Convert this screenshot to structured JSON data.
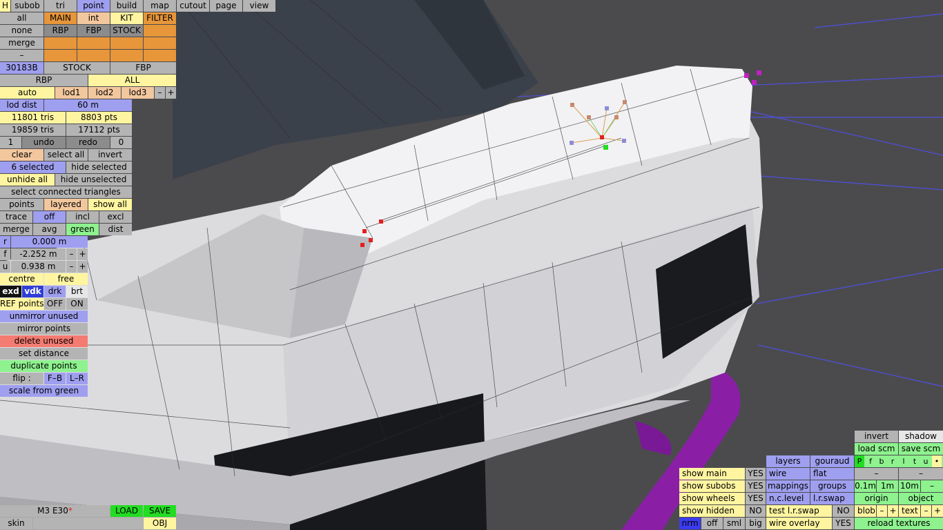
{
  "app": {
    "title": "M3 E30",
    "unsaved_mark": "*"
  },
  "menu": [
    "H",
    "subob",
    "tri",
    "point",
    "build",
    "map",
    "cutout",
    "page",
    "view"
  ],
  "kit_row1": [
    "all",
    "MAIN",
    "int",
    "KIT",
    "FILTER"
  ],
  "kit_row2": [
    "none",
    "RBP",
    "FBP",
    "STOCK"
  ],
  "kit_row3": [
    "merge"
  ],
  "kit_row4": [
    "–"
  ],
  "part_row": [
    "30183B",
    "STOCK",
    "FBP"
  ],
  "scope_row": [
    "RBP",
    "ALL"
  ],
  "lod_row": [
    "auto",
    "lod1",
    "lod2",
    "lod3",
    "–",
    "+"
  ],
  "lod_dist": {
    "label": "lod dist",
    "value": "60 m"
  },
  "stats1": {
    "tris": "11801 tris",
    "pts": "8803 pts"
  },
  "stats2": {
    "tris": "19859 tris",
    "pts": "17112 pts"
  },
  "undo_row": {
    "count": "1",
    "undo": "undo",
    "redo": "redo",
    "redo_count": "0"
  },
  "select_row1": [
    "clear",
    "select all",
    "invert"
  ],
  "select_row2": [
    "6 selected",
    "hide selected"
  ],
  "select_row3": [
    "unhide all",
    "hide unselected"
  ],
  "select_connected": "select connected triangles",
  "points_row": [
    "points",
    "layered",
    "show all"
  ],
  "trace_row": [
    "trace",
    "off",
    "incl",
    "excl"
  ],
  "merge_row": [
    "merge",
    "avg",
    "green",
    "dist"
  ],
  "coord_r": {
    "label": "r",
    "value": "0.000 m"
  },
  "coord_f": {
    "label": "f",
    "value": "-2.252 m",
    "minus": "–",
    "plus": "+"
  },
  "coord_u": {
    "label": "u",
    "value": "0.938 m",
    "minus": "–",
    "plus": "+"
  },
  "centre_row": [
    "centre",
    "free"
  ],
  "shade_row": [
    "exd",
    "vdk",
    "drk",
    "brt"
  ],
  "ref_row": [
    "REF points",
    "OFF",
    "ON"
  ],
  "actions": [
    "unmirror unused",
    "mirror points",
    "delete unused",
    "set distance",
    "duplicate points"
  ],
  "flip_row": [
    "flip :",
    "F–B",
    "L–R"
  ],
  "scale_green": "scale from green",
  "bottom_left": {
    "title": "M3 E30",
    "load": "LOAD",
    "save": "SAVE",
    "skin": "skin",
    "obj": "OBJ"
  },
  "br": {
    "invert": "invert",
    "shadow": "shadow",
    "load_scm": "load scm",
    "save_scm": "save scm",
    "layers": "layers",
    "gouraud": "gouraud",
    "checks": [
      "P",
      "f",
      "b",
      "r",
      "l",
      "t",
      "u",
      "•"
    ],
    "wire": "wire",
    "flat": "flat",
    "dash1": "–",
    "dash2": "–",
    "mappings": "mappings",
    "groups": "groups",
    "scale": [
      "0.1m",
      "1m",
      "10m",
      "–"
    ],
    "nclevel": "n.c.level",
    "lrswap": "l.r.swap",
    "origin": "origin",
    "object": "object",
    "test_lr": "test l.r.swap",
    "test_lr_val": "NO",
    "blob": "blob",
    "text": "text",
    "pm": [
      "–",
      "+"
    ],
    "wire_overlay": "wire overlay",
    "wire_overlay_val": "YES",
    "reload": "reload textures",
    "show": [
      {
        "label": "show main",
        "val": "YES"
      },
      {
        "label": "show subobs",
        "val": "YES"
      },
      {
        "label": "show wheels",
        "val": "YES"
      },
      {
        "label": "show hidden",
        "val": "NO"
      }
    ],
    "nrm_row": [
      "nrm",
      "off",
      "sml",
      "big"
    ]
  }
}
